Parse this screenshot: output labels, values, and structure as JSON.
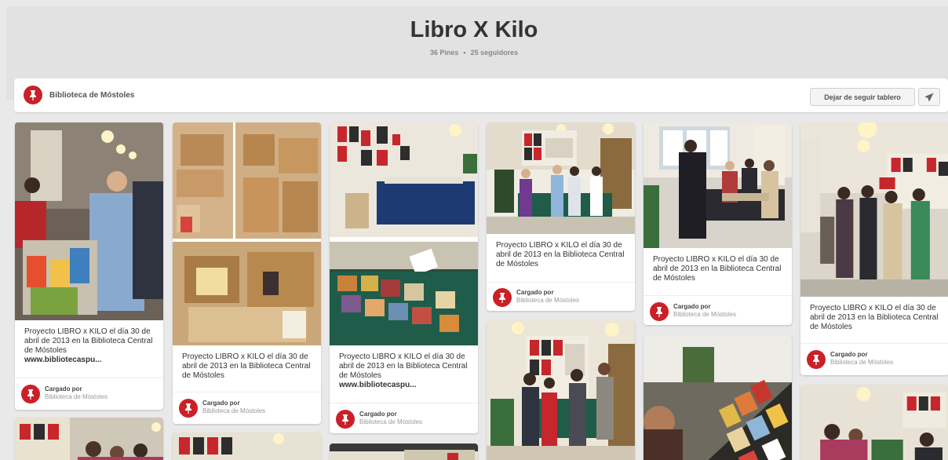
{
  "board": {
    "title": "Libro X Kilo",
    "pins_count": "36 Pines",
    "separator": "•",
    "followers_count": "25 seguidores"
  },
  "owner": {
    "name": "Biblioteca de Móstoles"
  },
  "actions": {
    "unfollow_label": "Dejar de seguir tablero",
    "send_icon": "paper-plane-icon"
  },
  "colors": {
    "accent": "#cb2027",
    "background": "#e9e9e9"
  },
  "pins": [
    {
      "description": "Proyecto LIBRO x KILO el día 30 de abril de 2013 en la Biblioteca Central de Móstoles",
      "url": "www.bibliotecaspu...",
      "credit_label": "Cargado por",
      "credit_name": "Biblioteca de Móstoles"
    },
    {
      "description": "Proyecto LIBRO x KILO el día 30 de abril de 2013 en la Biblioteca Central de Móstoles",
      "url": "",
      "credit_label": "Cargado por",
      "credit_name": "Biblioteca de Móstoles"
    },
    {
      "description": "Proyecto LIBRO x KILO el día 30 de abril de 2013 en la Biblioteca Central de Móstoles",
      "url": "www.bibliotecaspu...",
      "credit_label": "Cargado por",
      "credit_name": "Biblioteca de Móstoles"
    },
    {
      "description": "Proyecto LIBRO x KILO el día 30 de abril de 2013 en la Biblioteca Central de Móstoles",
      "url": "",
      "credit_label": "Cargado por",
      "credit_name": "Biblioteca de Móstoles"
    },
    {
      "description": "Proyecto LIBRO x KILO el día 30 de abril de 2013 en la Biblioteca Central de Móstoles",
      "url": "",
      "credit_label": "Cargado por",
      "credit_name": "Biblioteca de Móstoles"
    },
    {
      "description": "Proyecto LIBRO x KILO el día 30 de abril de 2013 en la Biblioteca Central de Móstoles",
      "url": "",
      "credit_label": "Cargado por",
      "credit_name": "Biblioteca de Móstoles"
    }
  ]
}
